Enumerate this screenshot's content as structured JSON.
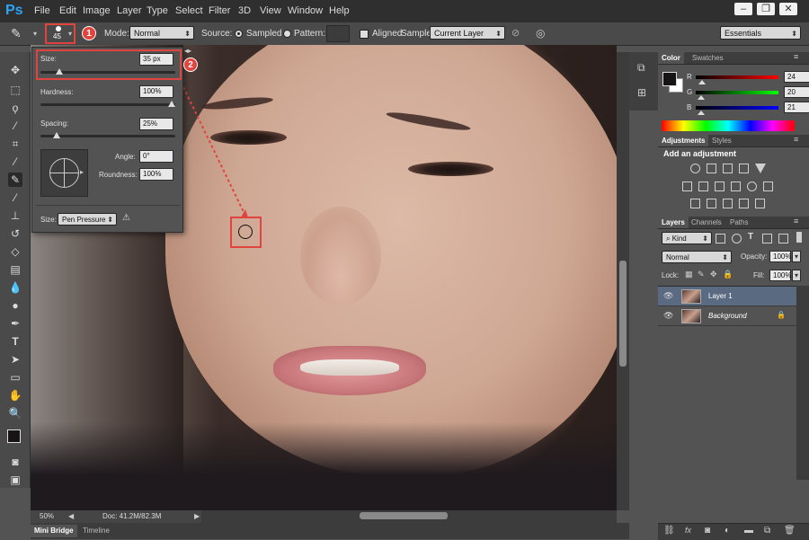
{
  "app": {
    "logo": "Ps"
  },
  "menubar": {
    "items": [
      "File",
      "Edit",
      "Image",
      "Layer",
      "Type",
      "Select",
      "Filter",
      "3D",
      "View",
      "Window",
      "Help"
    ]
  },
  "window_controls": {
    "minimize": "–",
    "restore": "❐",
    "close": "✕"
  },
  "options_bar": {
    "brush_size_number": "45",
    "mode_label": "Mode:",
    "mode_value": "Normal",
    "source_label": "Source:",
    "sampled_label": "Sampled",
    "pattern_label": "Pattern:",
    "aligned_label": "Aligned",
    "sample_label": "Sample:",
    "sample_value": "Current Layer",
    "workspace_value": "Essentials"
  },
  "brush_panel": {
    "size_label": "Size:",
    "size_value": "35 px",
    "size_fraction": 0.12,
    "hardness_label": "Hardness:",
    "hardness_value": "100%",
    "hardness_fraction": 1.0,
    "spacing_label": "Spacing:",
    "spacing_value": "25%",
    "spacing_fraction": 0.1,
    "angle_label": "Angle:",
    "angle_value": "0°",
    "roundness_label": "Roundness:",
    "roundness_value": "100%",
    "size_control_label": "Size:",
    "size_control_value": "Pen Pressure"
  },
  "annotations": {
    "badge_1": "1",
    "badge_2": "2"
  },
  "status_bar": {
    "zoom": "50%",
    "doc_info": "Doc: 41.2M/82.3M"
  },
  "bottom_tabs": {
    "mini_bridge": "Mini Bridge",
    "timeline": "Timeline"
  },
  "color_panel": {
    "tabs": [
      "Color",
      "Swatches"
    ],
    "r_label": "R",
    "r_value": "24",
    "g_label": "G",
    "g_value": "20",
    "b_label": "B",
    "b_value": "21"
  },
  "adjustments_panel": {
    "tabs": [
      "Adjustments",
      "Styles"
    ],
    "heading": "Add an adjustment"
  },
  "layers_panel": {
    "tabs": [
      "Layers",
      "Channels",
      "Paths"
    ],
    "filter_value": "Kind",
    "blend_value": "Normal",
    "opacity_label": "Opacity:",
    "opacity_value": "100%",
    "lock_label": "Lock:",
    "fill_label": "Fill:",
    "fill_value": "100%",
    "layers": [
      {
        "name": "Layer 1",
        "selected": true
      },
      {
        "name": "Background",
        "selected": false
      }
    ]
  },
  "colors": {
    "accent_red": "#e0443f",
    "ps_blue": "#2fa3f5",
    "selected_layer": "#5a6a80"
  }
}
